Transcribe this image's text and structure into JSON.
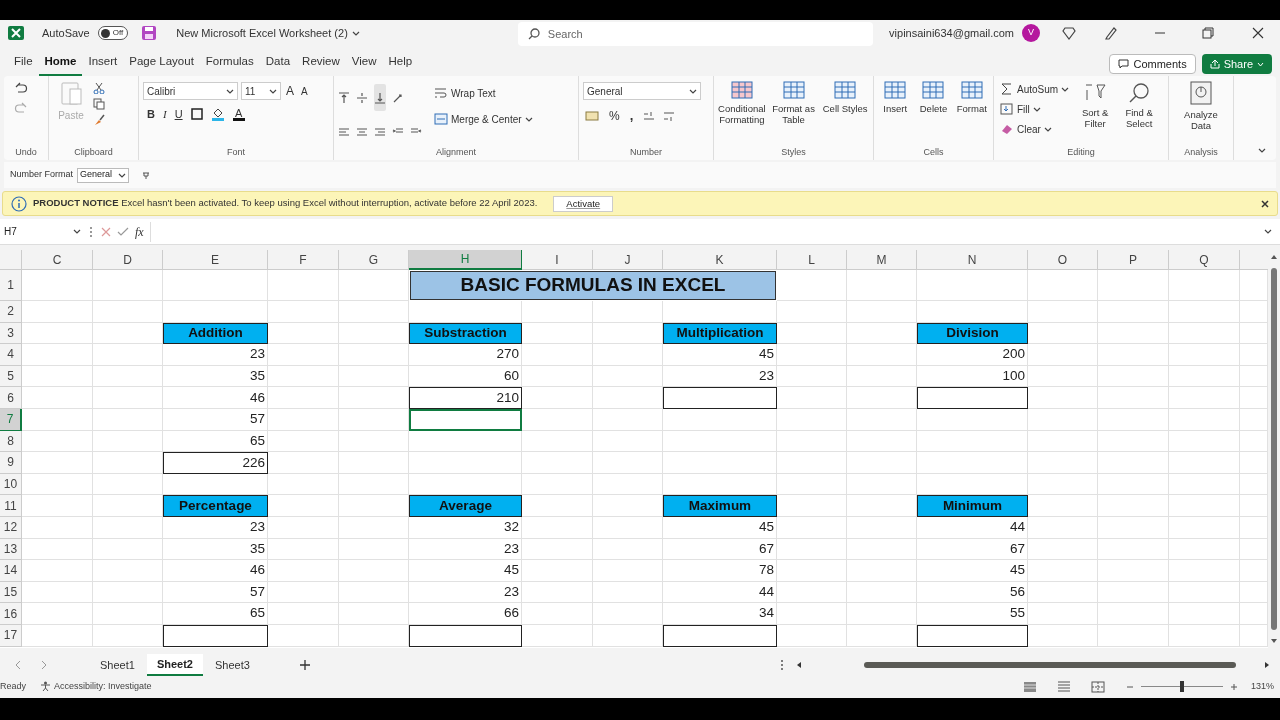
{
  "title_bar": {
    "autosave_label": "AutoSave",
    "autosave_state": "Off",
    "autosave_on": false,
    "file_name": "New Microsoft Excel Worksheet (2)",
    "search_placeholder": "Search",
    "account": "vipinsaini634@gmail.com",
    "avatar": "V"
  },
  "menu_tabs": [
    {
      "label": "File",
      "selected": false
    },
    {
      "label": "Home",
      "selected": true
    },
    {
      "label": "Insert",
      "selected": false
    },
    {
      "label": "Page Layout",
      "selected": false
    },
    {
      "label": "Formulas",
      "selected": false
    },
    {
      "label": "Data",
      "selected": false
    },
    {
      "label": "Review",
      "selected": false
    },
    {
      "label": "View",
      "selected": false
    },
    {
      "label": "Help",
      "selected": false
    }
  ],
  "comments_button": "Comments",
  "share_button": "Share",
  "ribbon": {
    "groups": [
      {
        "label": "Undo",
        "kind": "undo"
      },
      {
        "label": "Clipboard",
        "kind": "clipboard",
        "paste": "Paste",
        "paste_disabled": true
      },
      {
        "label": "Font",
        "kind": "font",
        "font_name": "Calibri",
        "font_size": "11",
        "grow": "A",
        "shrink": "A",
        "bold": "B",
        "italic": "I",
        "underline": "U",
        "font_color": "A"
      },
      {
        "label": "Alignment",
        "kind": "alignment",
        "wrap": "Wrap Text",
        "merge": "Merge & Center"
      },
      {
        "label": "Number",
        "kind": "number",
        "format": "General",
        "percent": "%",
        "comma": ","
      },
      {
        "label": "Styles",
        "kind": "big",
        "buttons": [
          "Conditional Formatting",
          "Format as Table",
          "Cell Styles"
        ]
      },
      {
        "label": "Cells",
        "kind": "big",
        "buttons": [
          "Insert",
          "Delete",
          "Format"
        ]
      },
      {
        "label": "Editing",
        "kind": "editing",
        "small": [
          "AutoSum",
          "Fill",
          "Clear"
        ],
        "buttons": [
          "Sort & Filter",
          "Find & Select"
        ]
      },
      {
        "label": "Analysis",
        "kind": "analysis",
        "buttons": [
          "Analyze Data"
        ]
      }
    ]
  },
  "number_format_bar": {
    "label": "Number Format",
    "value": "General"
  },
  "notice": {
    "text": "**PRODUCT NOTICE** Excel hasn't been activated. To keep using Excel without interruption, activate before 22 April 2023.",
    "button": "Activate"
  },
  "formula_bar": {
    "name_box": "H7",
    "function_label": "fx"
  },
  "sheet": {
    "columns": [
      "C",
      "D",
      "E",
      "F",
      "G",
      "H",
      "I",
      "J",
      "K",
      "L",
      "M",
      "N",
      "O",
      "P",
      "Q"
    ],
    "row_numbers": [
      "1",
      "2",
      "3",
      "4",
      "5",
      "6",
      "7",
      "8",
      "9",
      "10",
      "11",
      "12",
      "13",
      "14",
      "15",
      "16",
      "17"
    ],
    "title": "BASIC FORMULAS IN EXCEL",
    "tables": [
      {
        "header": "Addition",
        "values": [
          "23",
          "35",
          "46",
          "57",
          "65"
        ],
        "result": "226"
      },
      {
        "header": "Substraction",
        "values": [
          "270",
          "60"
        ],
        "result": "210"
      },
      {
        "header": "Multiplication",
        "values": [
          "45",
          "23"
        ]
      },
      {
        "header": "Division",
        "values": [
          "200",
          "100"
        ]
      },
      {
        "header": "Percentage",
        "values": [
          "23",
          "35",
          "46",
          "57",
          "65"
        ]
      },
      {
        "header": "Average",
        "values": [
          "32",
          "23",
          "45",
          "23",
          "66"
        ]
      },
      {
        "header": "Maximum",
        "values": [
          "45",
          "67",
          "78",
          "44",
          "34"
        ]
      },
      {
        "header": "Minimum",
        "values": [
          "44",
          "67",
          "45",
          "56",
          "55"
        ]
      }
    ]
  },
  "sheet_tabs": [
    {
      "label": "Sheet1",
      "selected": false
    },
    {
      "label": "Sheet2",
      "selected": true
    },
    {
      "label": "Sheet3",
      "selected": false
    }
  ],
  "status_bar": {
    "ready": "Ready",
    "accessibility": "Accessibility: Investigate",
    "zoom": {
      "level": 0.5,
      "reading": "131%"
    }
  }
}
